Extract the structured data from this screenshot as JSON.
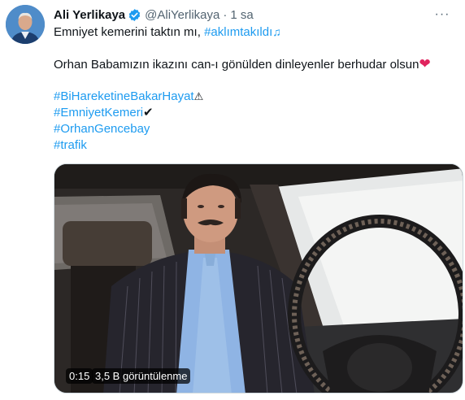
{
  "tweet": {
    "author_name": "Ali Yerlikaya",
    "author_handle": "@AliYerlikaya",
    "separator": "·",
    "time": "1 sa",
    "more_label": "···",
    "line1_text": "Emniyet kemerini taktın mı, ",
    "line1_hashtag": "#aklımtakıldı",
    "line1_emoji": "♫",
    "line2_text": "Orhan Babamızın ikazını can-ı gönülden dinleyenler berhudar olsun",
    "line2_emoji": "❤",
    "hashtags": [
      {
        "tag": "#BiHareketineBakarHayat",
        "emoji": "⚠"
      },
      {
        "tag": "#EmniyetKemeri",
        "emoji": "✔"
      },
      {
        "tag": "#OrhanGencebay",
        "emoji": ""
      },
      {
        "tag": "#trafik",
        "emoji": ""
      }
    ]
  },
  "video": {
    "duration": "0:15",
    "views": "3,5 B görüntülenme"
  },
  "colors": {
    "link": "#1d9bf0",
    "text": "#0f1419",
    "secondary": "#536471",
    "verified": "#1d9bf0",
    "heart": "#e0245e"
  },
  "icons": [
    "avatar",
    "verified-badge-icon",
    "more-options-icon",
    "music-notes-icon",
    "heart-icon",
    "warning-icon",
    "check-mark-icon"
  ]
}
